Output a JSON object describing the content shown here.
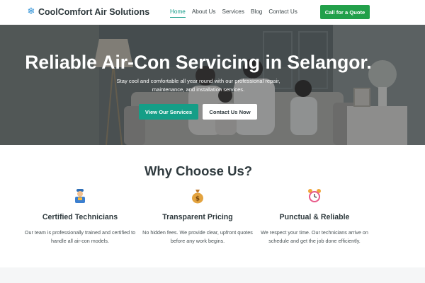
{
  "header": {
    "brand_icon": "snowflake-icon",
    "brand_name": "CoolComfort Air Solutions",
    "nav": [
      "Home",
      "About Us",
      "Services",
      "Blog",
      "Contact Us"
    ],
    "active_nav": "Home",
    "cta_label": "Call for a Quote"
  },
  "hero": {
    "title": "Reliable Air-Con Servicing in Selangor.",
    "subtitle": "Stay cool and comfortable all year round with our professional repair, maintenance, and installation services.",
    "primary_button": "View Our Services",
    "secondary_button": "Contact Us Now"
  },
  "why": {
    "title": "Why Choose Us?",
    "features": [
      {
        "icon": "technician-icon",
        "title": "Certified Technicians",
        "description": "Our team is professionally trained and certified to handle all air-con models."
      },
      {
        "icon": "money-bag-icon",
        "title": "Transparent Pricing",
        "description": "No hidden fees. We provide clear, upfront quotes before any work begins."
      },
      {
        "icon": "alarm-clock-icon",
        "title": "Punctual & Reliable",
        "description": "We respect your time. Our technicians arrive on schedule and get the job done efficiently."
      }
    ]
  },
  "colors": {
    "accent_teal": "#159e87",
    "cta_green": "#22a04a",
    "text_dark": "#2f3a3e",
    "brand_icon": "#2a8fd6"
  }
}
